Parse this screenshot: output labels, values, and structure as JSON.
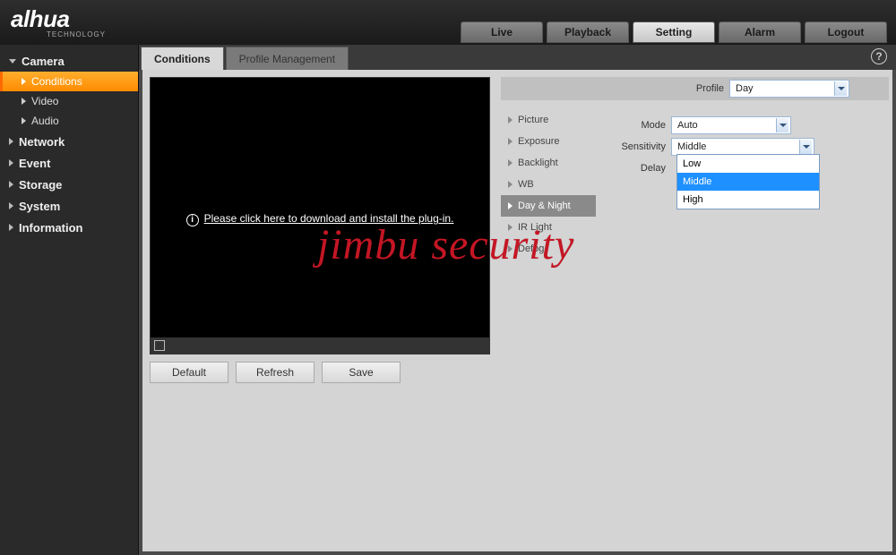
{
  "brand": {
    "name": "alhua",
    "sub": "TECHNOLOGY"
  },
  "topnav": {
    "live": "Live",
    "playback": "Playback",
    "setting": "Setting",
    "alarm": "Alarm",
    "logout": "Logout",
    "active": "setting"
  },
  "sidebar": {
    "camera": {
      "label": "Camera",
      "expanded": true
    },
    "conditions": {
      "label": "Conditions",
      "active": true
    },
    "video": {
      "label": "Video"
    },
    "audio": {
      "label": "Audio"
    },
    "network": {
      "label": "Network"
    },
    "event": {
      "label": "Event"
    },
    "storage": {
      "label": "Storage"
    },
    "system": {
      "label": "System"
    },
    "information": {
      "label": "Information"
    }
  },
  "tabs": {
    "conditions": "Conditions",
    "profileMgmt": "Profile Management",
    "active": "conditions"
  },
  "video": {
    "plugin_msg": "Please click here to download and install the plug-in."
  },
  "buttons": {
    "default": "Default",
    "refresh": "Refresh",
    "save": "Save"
  },
  "setcol": {
    "picture": "Picture",
    "exposure": "Exposure",
    "backlight": "Backlight",
    "wb": "WB",
    "daynight": "Day & Night",
    "irlight": "IR Light",
    "defog": "Defog",
    "active": "daynight"
  },
  "profile": {
    "label": "Profile",
    "value": "Day"
  },
  "form": {
    "mode": {
      "label": "Mode",
      "value": "Auto"
    },
    "sensitivity": {
      "label": "Sensitivity",
      "value": "Middle",
      "options": {
        "low": "Low",
        "middle": "Middle",
        "high": "High"
      },
      "selected": "middle"
    },
    "delay": {
      "label": "Delay"
    }
  },
  "help": "?",
  "watermark": "jimbu security"
}
